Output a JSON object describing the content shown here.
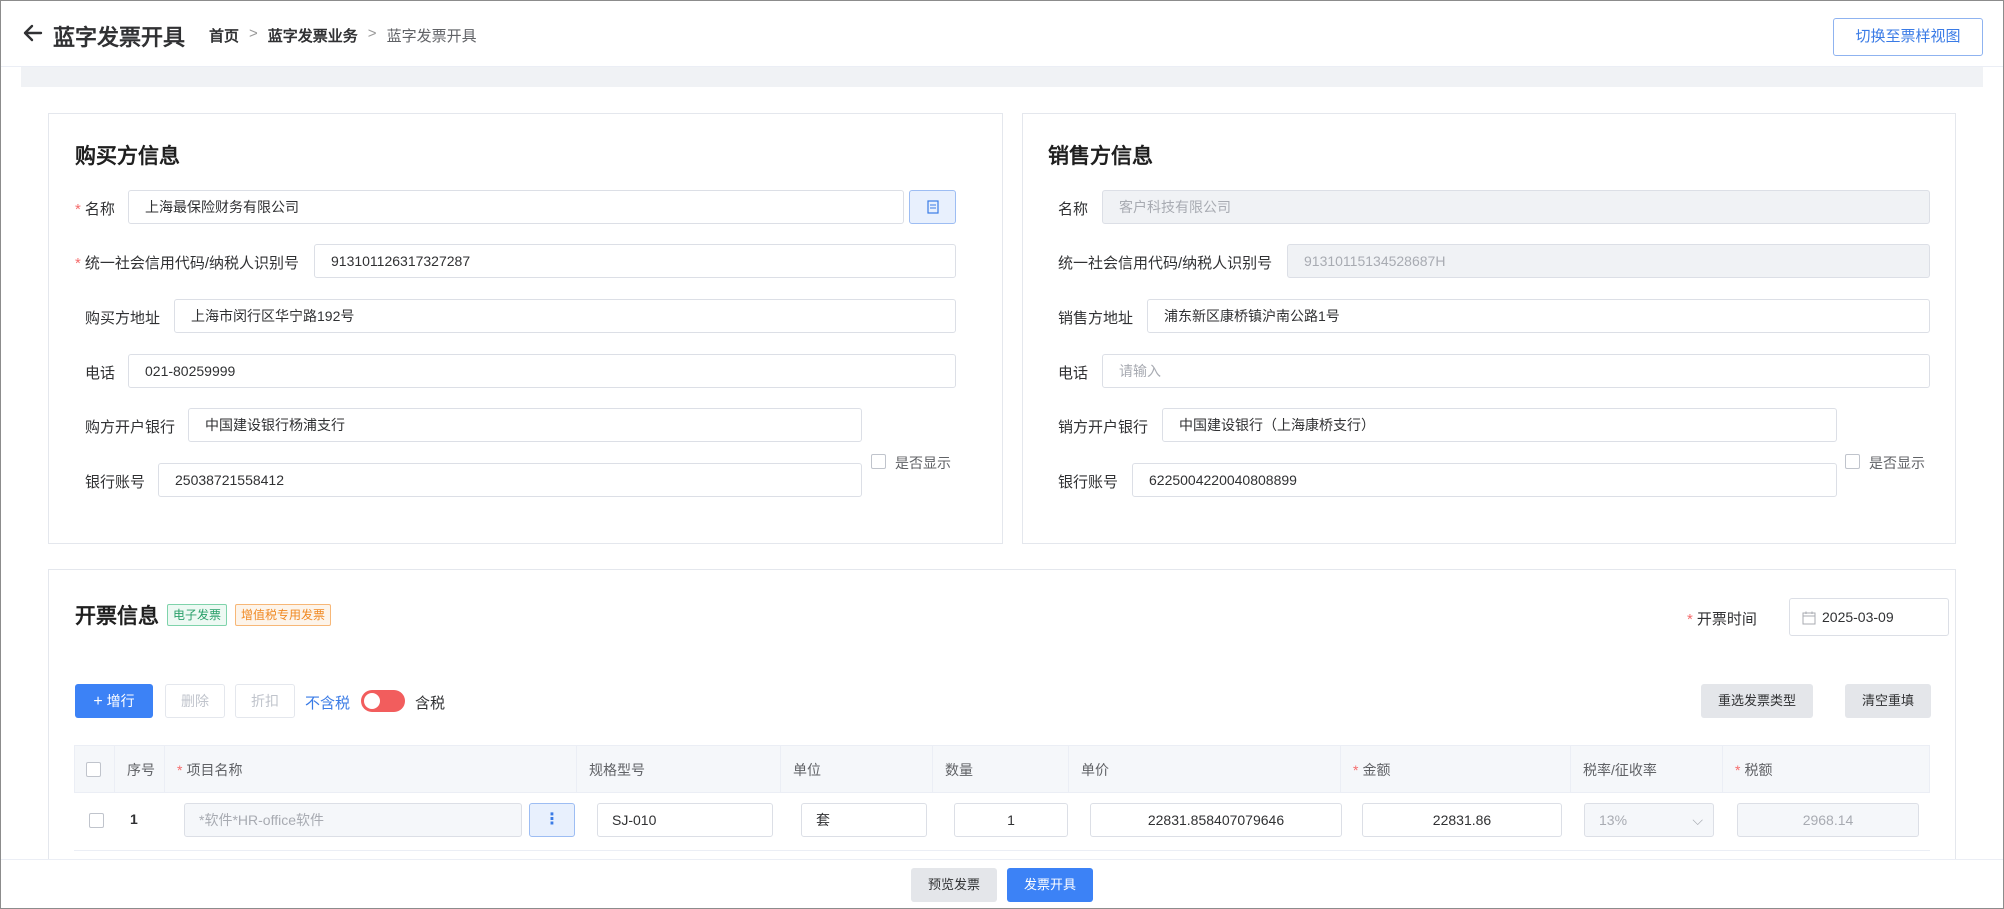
{
  "header": {
    "title": "蓝字发票开具",
    "breadcrumb": [
      "首页",
      "蓝字发票业务",
      "蓝字发票开具"
    ],
    "breadcrumb_sep": ">",
    "switch_view_label": "切换至票样视图"
  },
  "buyer": {
    "title": "购买方信息",
    "name_label": "名称",
    "name_value": "上海最保险财务有限公司",
    "tax_id_label": "统一社会信用代码/纳税人识别号",
    "tax_id_value": "913101126317327287",
    "address_label": "购买方地址",
    "address_value": "上海市闵行区华宁路192号",
    "phone_label": "电话",
    "phone_value": "021-80259999",
    "bank_label": "购方开户银行",
    "bank_value": "中国建设银行杨浦支行",
    "account_label": "银行账号",
    "account_value": "25038721558412",
    "show_label": "是否显示"
  },
  "seller": {
    "title": "销售方信息",
    "name_label": "名称",
    "name_value": "客户科技有限公司",
    "tax_id_label": "统一社会信用代码/纳税人识别号",
    "tax_id_value": "91310115134528687H",
    "address_label": "销售方地址",
    "address_value": "浦东新区康桥镇沪南公路1号",
    "phone_label": "电话",
    "phone_placeholder": "请输入",
    "bank_label": "销方开户银行",
    "bank_value": "中国建设银行（上海康桥支行）",
    "account_label": "银行账号",
    "account_value": "6225004220040808899",
    "show_label": "是否显示"
  },
  "invoice": {
    "title": "开票信息",
    "tag_electronic": "电子发票",
    "tag_vat": "增值税专用发票",
    "date_label": "开票时间",
    "date_value": "2025-03-09",
    "add_row": "增行",
    "delete": "删除",
    "discount": "折扣",
    "tax_excl": "不含税",
    "tax_incl": "含税",
    "reselect_type": "重选发票类型",
    "clear_refill": "清空重填"
  },
  "table": {
    "headers": [
      "序号",
      "项目名称",
      "规格型号",
      "单位",
      "数量",
      "单价",
      "金额",
      "税率/征收率",
      "税额"
    ],
    "rows": [
      {
        "index": "1",
        "item_name": "*软件*HR-office软件",
        "spec": "SJ-010",
        "unit": "套",
        "qty": "1",
        "unit_price": "22831.858407079646",
        "amount": "22831.86",
        "tax_rate": "13%",
        "tax": "2968.14"
      }
    ]
  },
  "footer": {
    "preview": "预览发票",
    "issue": "发票开具"
  }
}
